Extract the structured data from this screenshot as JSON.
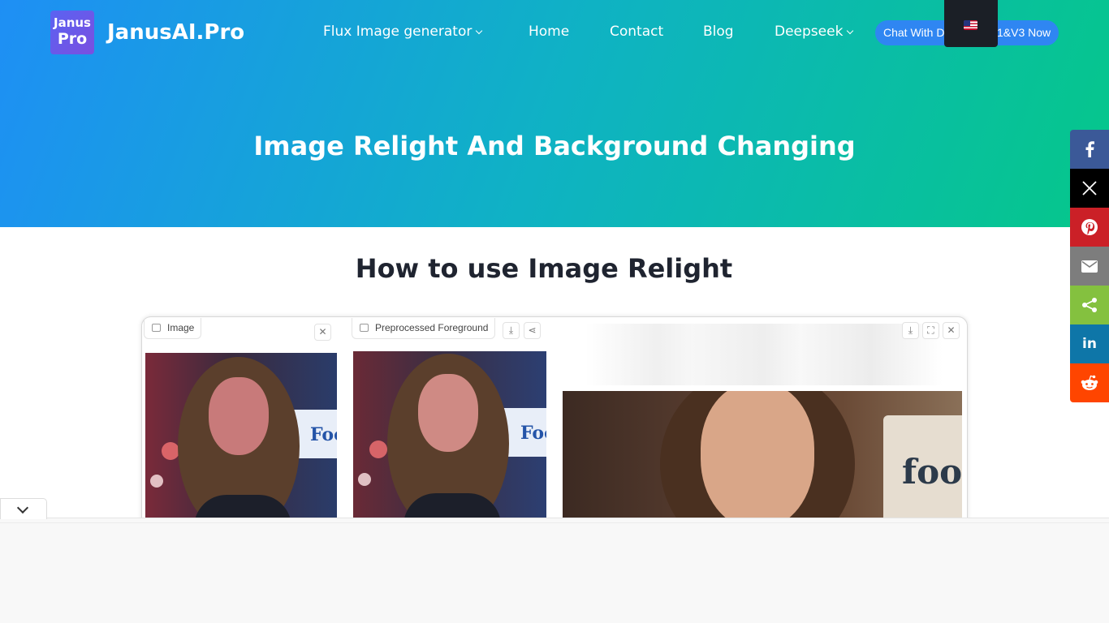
{
  "header": {
    "logo_line1": "Janus",
    "logo_line2": "Pro",
    "site_name": "JanusAI.Pro",
    "nav": [
      {
        "label": "Flux Image generator"
      },
      {
        "label": "Home"
      },
      {
        "label": "Contact"
      },
      {
        "label": "Blog"
      },
      {
        "label": "Deepseek"
      }
    ],
    "cta_left": "Chat With D",
    "cta_right": "1&V3 Now",
    "language": "en-US flag"
  },
  "hero": {
    "title": "Image Relight And Background Changing"
  },
  "main": {
    "section_title": "How to use Image Relight",
    "screenshot": {
      "panel1_label": "Image",
      "panel2_label": "Preprocessed Foreground",
      "panel1_sign": "Foot",
      "panel2_sign": "Foot",
      "panel3_sign": "foot"
    }
  },
  "share": {
    "buttons": [
      "facebook",
      "x",
      "pinterest",
      "email",
      "share",
      "linkedin",
      "reddit"
    ],
    "linkedin_label": "in"
  },
  "colors": {
    "hero_start": "#1e8ff5",
    "hero_end": "#05c78a",
    "cta_bg": "#2f86f2",
    "facebook": "#3b5998",
    "pinterest": "#cb2027",
    "share": "#84c13f",
    "linkedin": "#0e76a8",
    "reddit": "#ff4500"
  }
}
